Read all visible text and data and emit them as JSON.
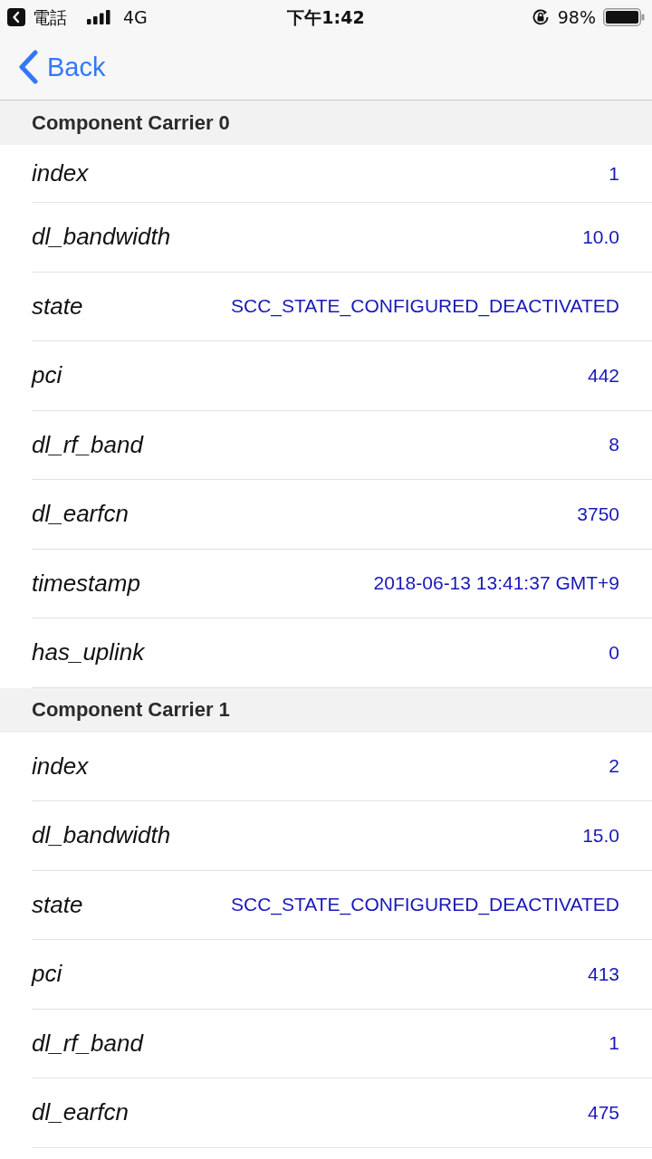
{
  "status_bar": {
    "back_app": "電話",
    "network": "4G",
    "time": "下午1:42",
    "battery": "98%"
  },
  "nav": {
    "back": "Back"
  },
  "sections": [
    {
      "title": "Component Carrier 0",
      "rows": [
        {
          "key": "index",
          "value": "1"
        },
        {
          "key": "dl_bandwidth",
          "value": "10.0"
        },
        {
          "key": "state",
          "value": "SCC_STATE_CONFIGURED_DEACTIVATED"
        },
        {
          "key": "pci",
          "value": "442"
        },
        {
          "key": "dl_rf_band",
          "value": "8"
        },
        {
          "key": "dl_earfcn",
          "value": "3750"
        },
        {
          "key": "timestamp",
          "value": "2018-06-13 13:41:37 GMT+9"
        },
        {
          "key": "has_uplink",
          "value": "0"
        }
      ]
    },
    {
      "title": "Component Carrier 1",
      "rows": [
        {
          "key": "index",
          "value": "2"
        },
        {
          "key": "dl_bandwidth",
          "value": "15.0"
        },
        {
          "key": "state",
          "value": "SCC_STATE_CONFIGURED_DEACTIVATED"
        },
        {
          "key": "pci",
          "value": "413"
        },
        {
          "key": "dl_rf_band",
          "value": "1"
        },
        {
          "key": "dl_earfcn",
          "value": "475"
        }
      ]
    }
  ]
}
